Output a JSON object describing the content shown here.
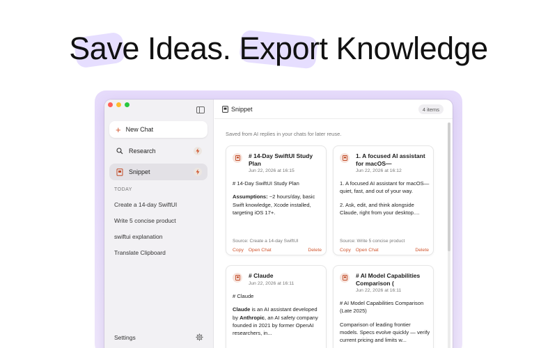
{
  "headline": "Save Ideas. Export Knowledge",
  "sidebar": {
    "new_chat": "New Chat",
    "items": [
      {
        "label": "Research",
        "icon": "magnifier-icon"
      },
      {
        "label": "Snippet",
        "icon": "snippet-icon"
      }
    ],
    "section": "TODAY",
    "history": [
      "Create a 14-day SwiftUI",
      "Write 5 concise product",
      "swiftui explanation",
      "Translate Clipboard"
    ],
    "settings": "Settings"
  },
  "main": {
    "title": "Snippet",
    "count": "4 items",
    "subtitle": "Saved from AI replies in your chats for later reuse.",
    "cards": [
      {
        "title": "# 14-Day SwiftUI Study Plan",
        "date": "Jun 22, 2026 at 16:15",
        "line1": "# 14-Day SwiftUI Study Plan",
        "bold": "Assumptions:",
        "rest": " ~2 hours/day, basic Swift knowledge, Xcode installed, targeting iOS 17+.",
        "source": "Source: Create a 14-day SwiftUI",
        "copy": "Copy",
        "open": "Open Chat",
        "delete": "Delete"
      },
      {
        "title": "1. A focused AI assistant for macOS—",
        "date": "Jun 22, 2026 at 16:12",
        "line1": "1. A focused AI assistant for macOS—quiet, fast, and out of your way.",
        "line2": "2. Ask, edit, and think alongside Claude, right from your desktop....",
        "source": "Source: Write 5 concise product",
        "copy": "Copy",
        "open": "Open Chat",
        "delete": "Delete"
      },
      {
        "title": "# Claude",
        "date": "Jun 22, 2026 at 16:11",
        "line1": "# Claude",
        "bold1": "Claude",
        "mid": " is an AI assistant developed by ",
        "bold2": "Anthropic",
        "rest": ", an AI safety company founded in 2021 by former OpenAI researchers, in..."
      },
      {
        "title": "# AI Model Capabilities Comparison (",
        "date": "Jun 22, 2026 at 16:11",
        "line1": "# AI Model Capabilities Comparison (Late 2025)",
        "line2": "Comparison of leading frontier models. Specs evolve quickly — verify current pricing and limits w..."
      }
    ]
  },
  "colors": {
    "accent": "#d0542c",
    "frame": "#e6dbfb",
    "highlight": "#d9ccff"
  }
}
